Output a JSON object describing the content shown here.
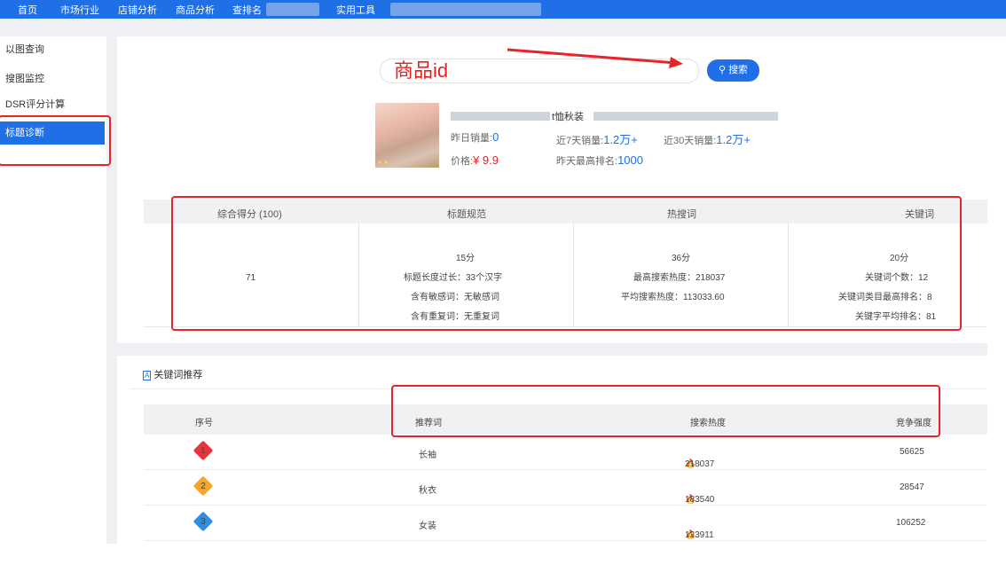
{
  "nav": {
    "items": [
      "首页",
      "市场行业",
      "店铺分析",
      "商品分析",
      "查排名",
      "实用工具"
    ],
    "active": "实用工具"
  },
  "sidebar": {
    "items": [
      "以图查询",
      "搜图监控",
      "DSR评分计算",
      "标题诊断"
    ],
    "active": "标题诊断"
  },
  "search": {
    "overlay_text": "商品id",
    "button_label": "搜索",
    "search_icon": "magnifier-icon"
  },
  "product": {
    "title_fragment": "t恤秋装",
    "yesterday_sales_label": "昨日销量:",
    "yesterday_sales": "0",
    "sales7_label": "近7天销量:",
    "sales7": "1.2万+",
    "sales30_label": "近30天销量:",
    "sales30": "1.2万+",
    "price_label": "价格:",
    "price": "¥ 9.9",
    "rank_label": "昨天最高排名:",
    "rank": "1000"
  },
  "score_table": {
    "headers": [
      "综合得分 (100)",
      "标题规范",
      "热搜词",
      "关键词"
    ],
    "total": "71",
    "title_norm": {
      "score": "15分",
      "lines": [
        "标题长度过长：33个汉字",
        "含有敏感词：无敏感词",
        "含有重复词：无重复词"
      ]
    },
    "hot_words": {
      "score": "36分",
      "lines": [
        "最高搜索热度：218037",
        "平均搜索热度：113033.60"
      ]
    },
    "keywords": {
      "score": "20分",
      "lines": [
        "关键词个数：12",
        "关键词类目最高排名：8",
        "关键字平均排名：81"
      ]
    }
  },
  "keyword_section": {
    "title": "关键词推荐",
    "headers": [
      "序号",
      "推荐词",
      "搜索热度",
      "竞争强度"
    ],
    "rows": [
      {
        "rank": "1",
        "word": "长袖",
        "heat": "218037",
        "competition": "56625",
        "gem_color": "#e8323c"
      },
      {
        "rank": "2",
        "word": "秋衣",
        "heat": "183540",
        "competition": "28547",
        "gem_color": "#f5a623"
      },
      {
        "rank": "3",
        "word": "女装",
        "heat": "123911",
        "competition": "106252",
        "gem_color": "#2f8de4"
      }
    ]
  },
  "colors": {
    "accent": "#1f6fe6",
    "annotation_red": "#e8232a",
    "heat_red": "#e02424"
  }
}
